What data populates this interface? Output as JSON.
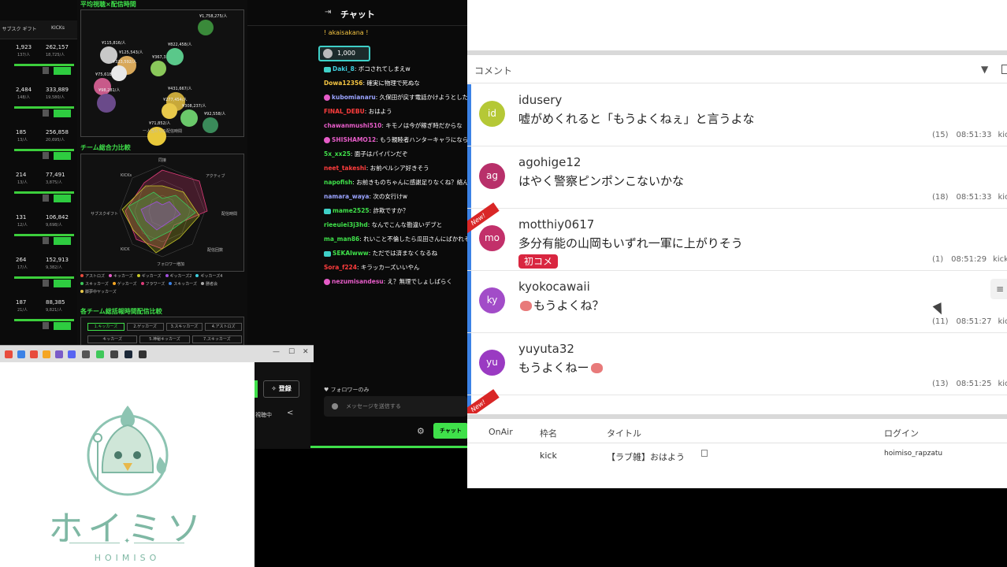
{
  "stats": {
    "headers": [
      "サブスク\nギフト",
      "KICKs"
    ],
    "rows": [
      {
        "v1": "1,923",
        "s1": "137/人",
        "v2": "262,157",
        "s2": "18,725/人"
      },
      {
        "v1": "2,484",
        "s1": "148/人",
        "v2": "333,889",
        "s2": "19,580/人"
      },
      {
        "v1": "185",
        "s1": "13/人",
        "v2": "256,858",
        "s2": "20,695/人"
      },
      {
        "v1": "214",
        "s1": "13/人",
        "v2": "77,491",
        "s2": "3,875/人"
      },
      {
        "v1": "131",
        "s1": "12/人",
        "v2": "106,842",
        "s2": "9,698/人"
      },
      {
        "v1": "264",
        "s1": "17/人",
        "v2": "152,913",
        "s2": "9,382/人"
      },
      {
        "v1": "187",
        "s1": "21/人",
        "v2": "88,385",
        "s2": "9,821/人"
      }
    ]
  },
  "charts": {
    "scatter_title": "平均視聴×配信時間",
    "scatter_xlabel": "一人当たりの配信時間",
    "bubbles": [
      "¥1,758,275/人",
      "¥115,816/人",
      "¥125,543/人",
      "¥323,592/人",
      "¥75,618/人",
      "¥98,281/人",
      "¥367,336/人",
      "¥822,458/人",
      "¥431,667/人",
      "¥277,454/人",
      "¥308,237/人",
      "¥71,852/人",
      "¥92,558/人"
    ],
    "radar_title": "チーム総合力比較",
    "radar_axes": [
      "同接",
      "アクティブ",
      "配信時間",
      "配信回数",
      "フォロワー増加",
      "KICK",
      "サブスクギフト",
      "KICKs"
    ],
    "legend": [
      "アストロズ",
      "キッカーズ",
      "ギッカーズ",
      "ギッカーズ2",
      "ギッカーズ4",
      "スキッカーズ",
      "ゲッカーズ",
      "フラワーズ",
      "スキッカーズ",
      "勝者会",
      "脚夢中ヤッカーズ"
    ],
    "compare_title": "各チーム総括報時間配信比較",
    "compare_tabs": [
      "1.キッカーズ",
      "2.ゲッカーズ",
      "3.スキッカーズ",
      "4.アストロズ"
    ],
    "compare_tabs2": [
      "キッカーズ",
      "5.神秘キッカーズ",
      "7.スキッカーズ"
    ]
  },
  "chat": {
    "title": "チャット",
    "pinned": "! akaisakana !",
    "badge": "1,000",
    "messages": [
      {
        "user": "Daki_8",
        "text": ": ボコされてしまえw",
        "color": "#3fd0e0",
        "icon": "sq"
      },
      {
        "user": "Dowa12356",
        "text": ": 確実に物理で死ぬな",
        "color": "#f5c542",
        "icon": ""
      },
      {
        "user": "kubomianaru",
        "text": ": 久保田が戻す電話かけようとしたら着物が阻止してたぞ",
        "color": "#9aa3ff",
        "icon": "rd"
      },
      {
        "user": "FINAL_DEBU",
        "text": ": おはよう",
        "color": "#ff3d3d",
        "icon": ""
      },
      {
        "user": "chawanmushi510",
        "text": ": キモノは今が稼ぎ時だからな",
        "color": "#e65cc8",
        "icon": ""
      },
      {
        "user": "SHISHAMO12",
        "text": ": もう親睦者ハンターキャラにならないか？",
        "color": "#e65cc8",
        "icon": "rd"
      },
      {
        "user": "5x_xx25",
        "text": ": 面子はパイパンだぞ",
        "color": "#3fe04a",
        "icon": ""
      },
      {
        "user": "neet_takeshi",
        "text": ": お前ペルシア好きそう",
        "color": "#ff3d3d",
        "icon": ""
      },
      {
        "user": "napofish",
        "text": ": お前きものちゃんに感謝足りなくね？絡んでもらっただけでもありがたいと思えよ",
        "color": "#3fe04a",
        "icon": ""
      },
      {
        "user": "namara_waya",
        "text": ": 次の女行けw",
        "color": "#9aa3ff",
        "icon": ""
      },
      {
        "user": "mame2525",
        "text": ": 詐欺ですか？",
        "color": "#3fe04a",
        "icon": "sq"
      },
      {
        "user": "rieeuiei3j3hd",
        "text": ": なんでこんな勘違いデブと",
        "color": "#3fe04a",
        "icon": ""
      },
      {
        "user": "ma_man86",
        "text": ": れいこと不倫したら瓜田さんにばかれそうw",
        "color": "#3fe04a",
        "icon": ""
      },
      {
        "user": "SEKAIwww",
        "text": ": ただでは済まなくなるね",
        "color": "#3fe04a",
        "icon": "sq"
      },
      {
        "user": "Sora_f224",
        "text": ": キラッカーズいいやん",
        "color": "#ff3d3d",
        "icon": ""
      },
      {
        "user": "nezumisandesu",
        "text": ": え？無理でしょしばらく",
        "color": "#e65cc8",
        "icon": "rd"
      }
    ],
    "follow_only": "♥ フォロワーのみ",
    "input_placeholder": "メッセージを送信する",
    "send_label": "チャット"
  },
  "mini": {
    "register_label": "✧ 登録",
    "watching": "視聴中"
  },
  "logo": {
    "name": "ホイミソ",
    "sub": "HOIMISO"
  },
  "comments": {
    "header_label": "コメント",
    "rows": [
      {
        "initials": "id",
        "color": "#b5c836",
        "user": "idusery",
        "text": "嘘がめくれると「もうよくねぇ」と言うよな",
        "count": "(15)",
        "time": "08:51:33",
        "src": "kick",
        "new": false,
        "first": false,
        "emoji_before": false,
        "emoji_after": false
      },
      {
        "initials": "ag",
        "color": "#b8306a",
        "user": "agohige12",
        "text": "はやく警察ピンポンこないかな",
        "count": "(18)",
        "time": "08:51:33",
        "src": "kick",
        "new": false,
        "first": false,
        "emoji_before": false,
        "emoji_after": false
      },
      {
        "initials": "mo",
        "color": "#c2306a",
        "user": "motthiy0617",
        "text": "多分有能の山岡もいずれ一軍に上がりそう",
        "count": "(1)",
        "time": "08:51:29",
        "src": "kick",
        "new": true,
        "first": true,
        "emoji_before": false,
        "emoji_after": false
      },
      {
        "initials": "ky",
        "color": "#a24cc8",
        "user": "kyokocawaii",
        "text": "もうよくね？",
        "count": "(11)",
        "time": "08:51:27",
        "src": "kick",
        "new": false,
        "first": false,
        "emoji_before": true,
        "emoji_after": false
      },
      {
        "initials": "yu",
        "color": "#9a3ac2",
        "user": "yuyuta32",
        "text": "もうよくねー",
        "count": "(13)",
        "time": "08:51:25",
        "src": "kick",
        "new": false,
        "first": false,
        "emoji_before": false,
        "emoji_after": true
      }
    ],
    "new_label": "New!",
    "first_label": "初コメ",
    "table": {
      "headers": [
        "OnAir",
        "枠名",
        "タイトル",
        "ログイン"
      ],
      "row": {
        "onair": "",
        "waku": "kick",
        "title": "【ラブ雑】おはよう",
        "login": "hoimiso_rapzatu"
      }
    }
  }
}
